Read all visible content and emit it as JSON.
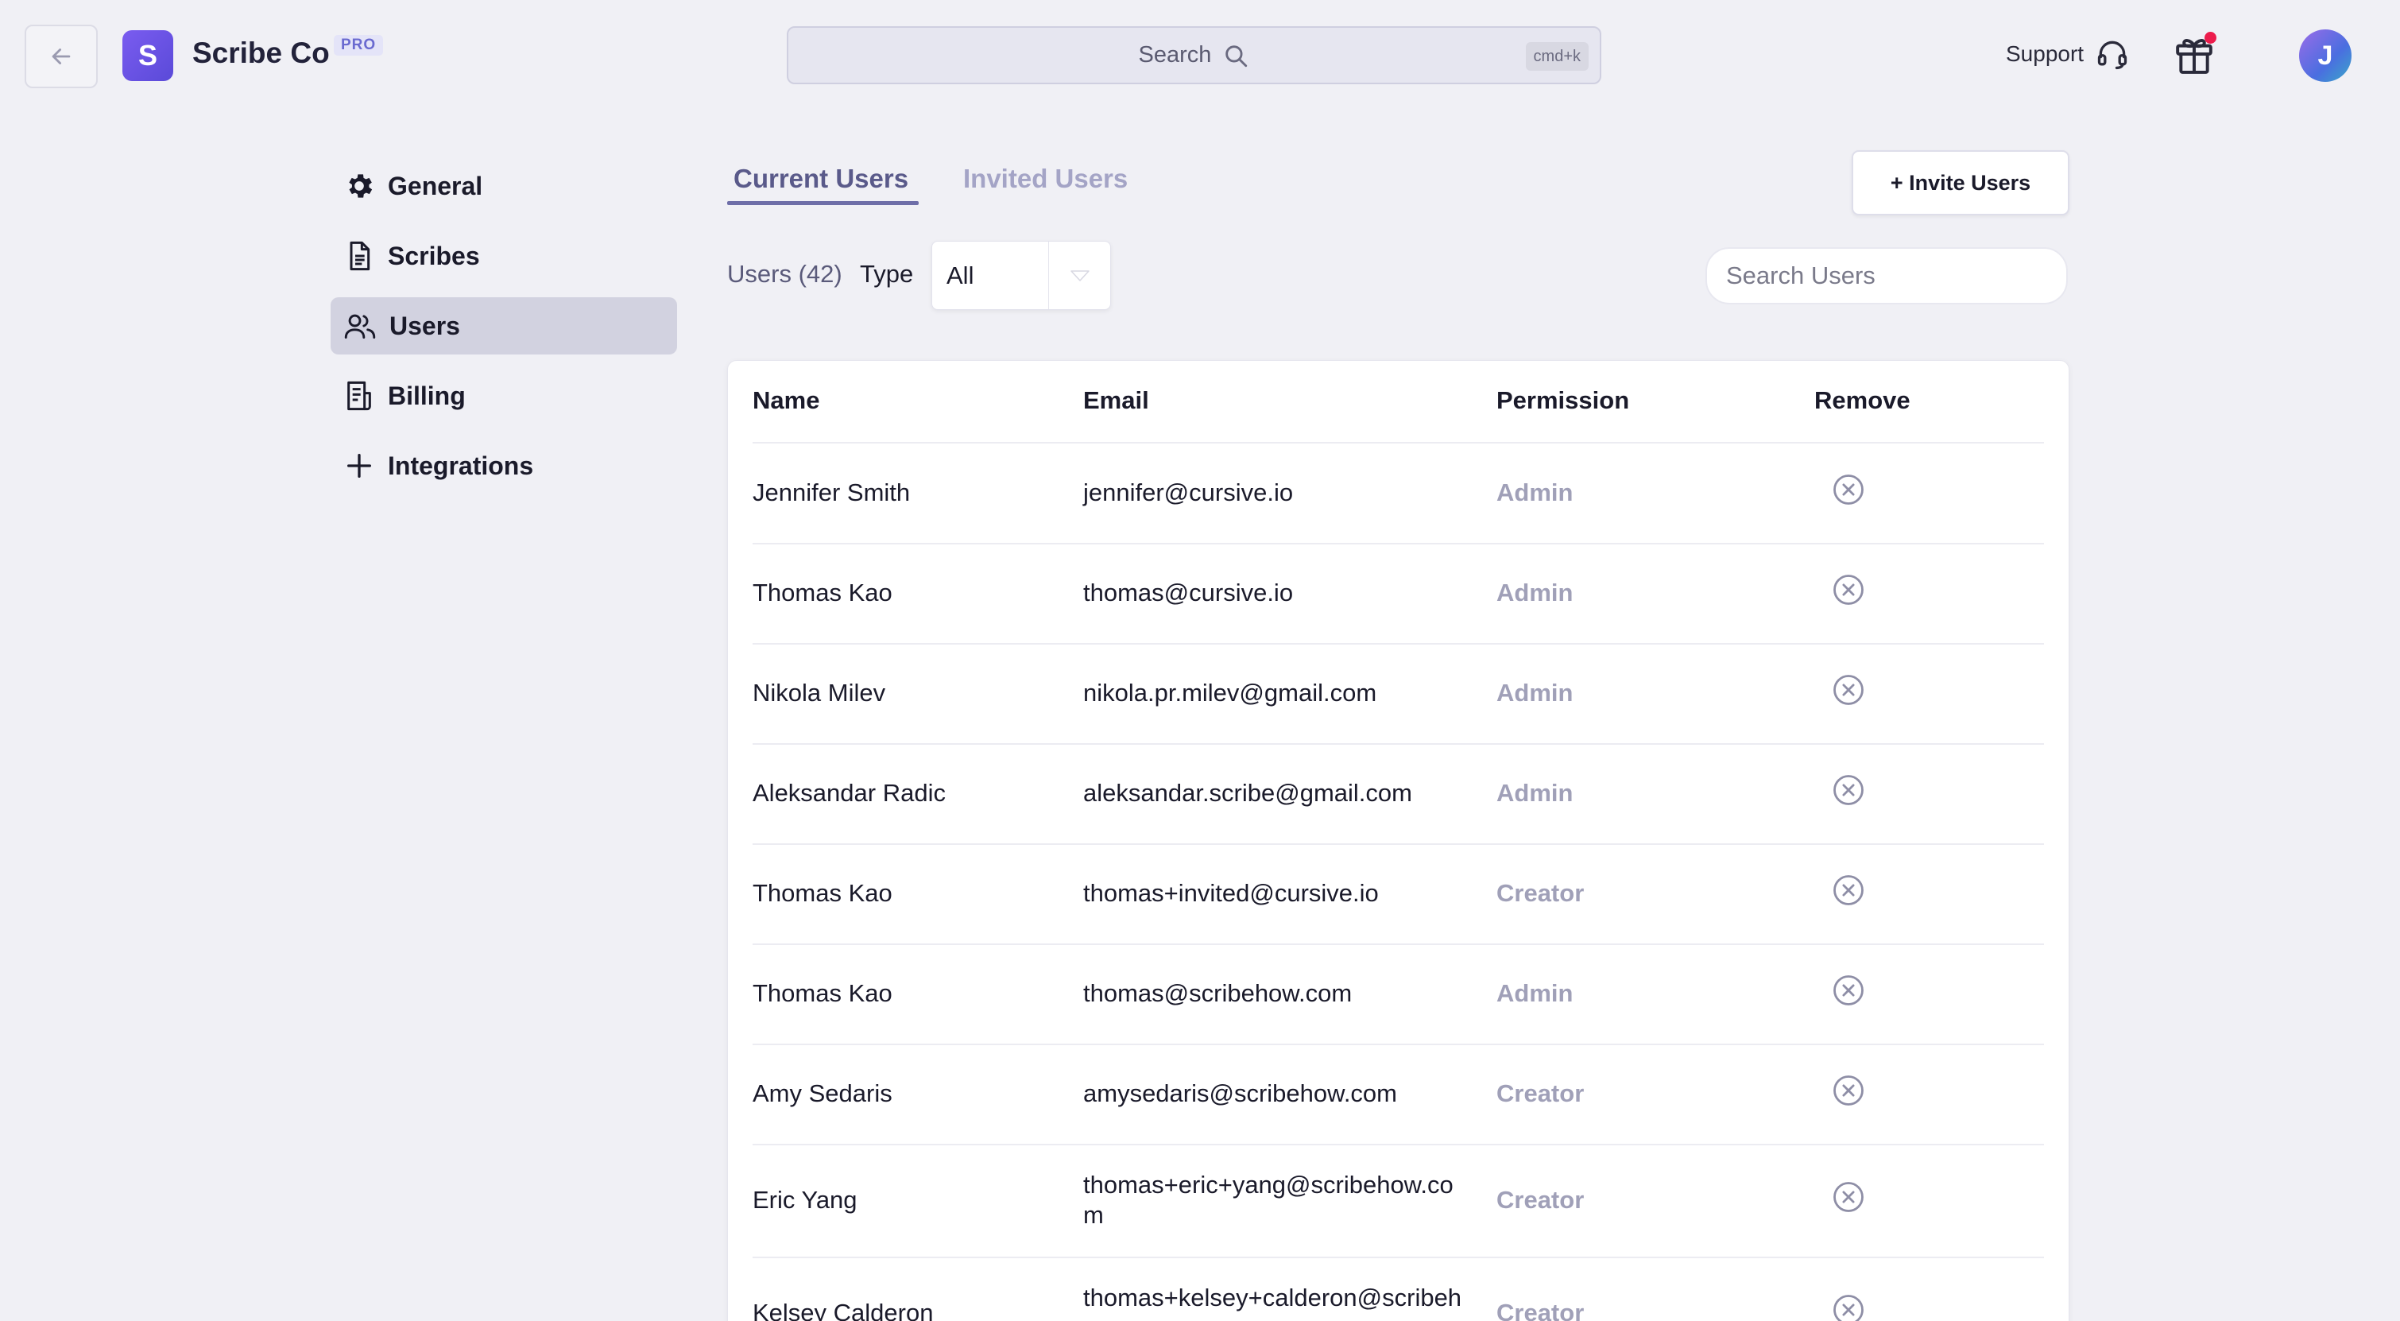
{
  "header": {
    "org_initial": "S",
    "org_name": "Scribe Co",
    "plan_badge": "PRO",
    "search_label": "Search",
    "search_shortcut": "cmd+k",
    "support_label": "Support",
    "avatar_initial": "J"
  },
  "sidebar": {
    "items": [
      {
        "label": "General",
        "icon": "gear-icon"
      },
      {
        "label": "Scribes",
        "icon": "document-icon"
      },
      {
        "label": "Users",
        "icon": "users-icon",
        "active": true
      },
      {
        "label": "Billing",
        "icon": "receipt-icon"
      },
      {
        "label": "Integrations",
        "icon": "plus-icon"
      }
    ]
  },
  "tabs": {
    "current": "Current Users",
    "invited": "Invited Users"
  },
  "invite_button": "+ Invite Users",
  "filters": {
    "users_count": "Users (42)",
    "type_label": "Type",
    "type_value": "All",
    "search_placeholder": "Search Users"
  },
  "table": {
    "columns": [
      "Name",
      "Email",
      "Permission",
      "Remove"
    ],
    "rows": [
      {
        "name": "Jennifer Smith",
        "email": "jennifer@cursive.io",
        "permission": "Admin"
      },
      {
        "name": "Thomas Kao",
        "email": "thomas@cursive.io",
        "permission": "Admin"
      },
      {
        "name": "Nikola Milev",
        "email": "nikola.pr.milev@gmail.com",
        "permission": "Admin"
      },
      {
        "name": "Aleksandar Radic",
        "email": "aleksandar.scribe@gmail.com",
        "permission": "Admin"
      },
      {
        "name": "Thomas Kao",
        "email": "thomas+invited@cursive.io",
        "permission": "Creator"
      },
      {
        "name": "Thomas Kao",
        "email": "thomas@scribehow.com",
        "permission": "Admin"
      },
      {
        "name": "Amy Sedaris",
        "email": "amysedaris@scribehow.com",
        "permission": "Creator"
      },
      {
        "name": "Eric Yang",
        "email": "thomas+eric+yang@scribehow.com",
        "permission": "Creator"
      },
      {
        "name": "Kelsey Calderon",
        "email": "thomas+kelsey+calderon@scribehow.com",
        "permission": "Creator"
      }
    ]
  },
  "colors": {
    "accent": "#6e6ea8",
    "brand": "#6a52e6",
    "notification": "#ec1c4c"
  }
}
